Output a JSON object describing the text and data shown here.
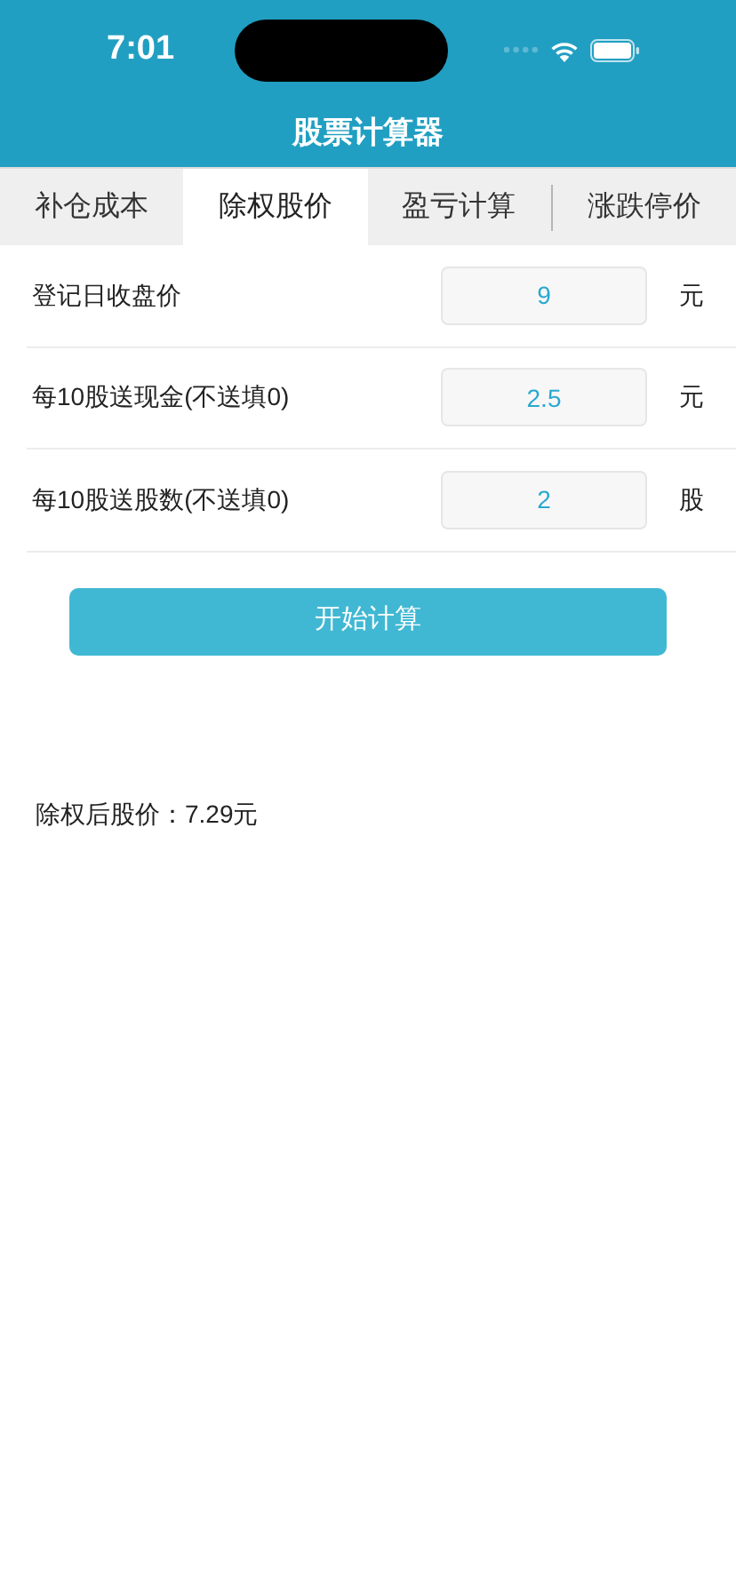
{
  "status_bar": {
    "time": "7:01"
  },
  "title": "股票计算器",
  "tabs": [
    {
      "label": "补仓成本",
      "selected": false
    },
    {
      "label": "除权股价",
      "selected": true
    },
    {
      "label": "盈亏计算",
      "selected": false
    },
    {
      "label": "涨跌停价",
      "selected": false
    }
  ],
  "fields": [
    {
      "label": "登记日收盘价",
      "value": "9",
      "unit": "元"
    },
    {
      "label": "每10股送现金(不送填0)",
      "value": "2.5",
      "unit": "元"
    },
    {
      "label": "每10股送股数(不送填0)",
      "value": "2",
      "unit": "股"
    }
  ],
  "button": "开始计算",
  "result": "除权后股价：7.29元"
}
